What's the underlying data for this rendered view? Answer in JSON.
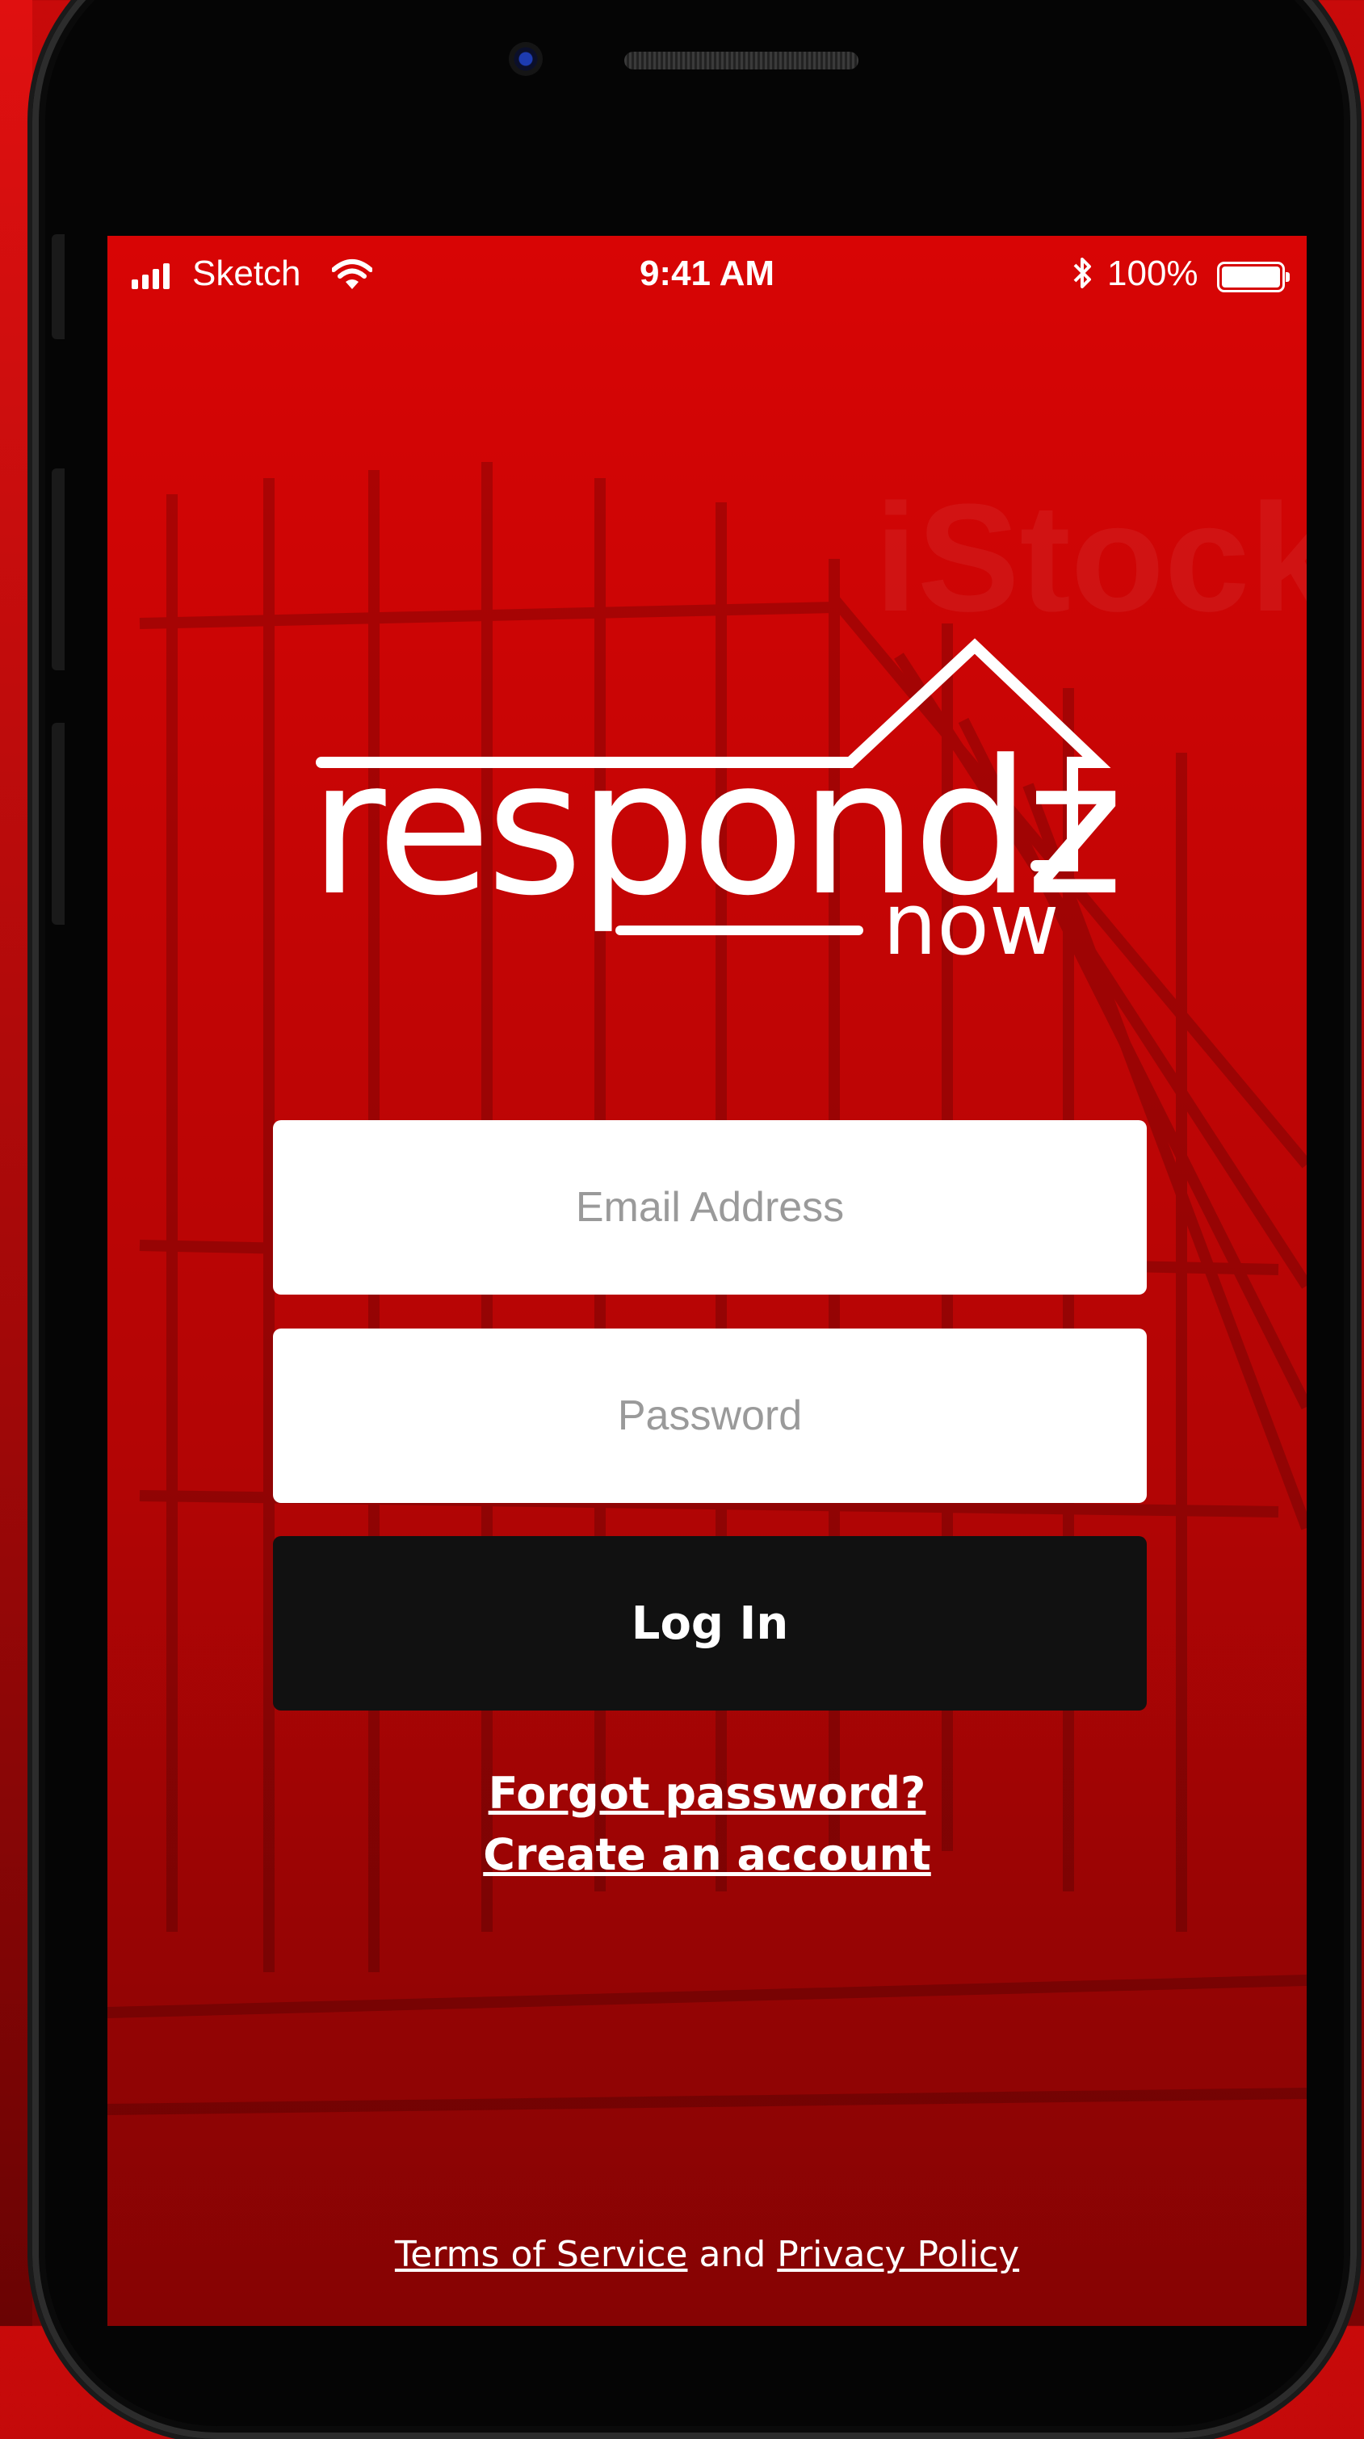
{
  "status_bar": {
    "carrier": "Sketch",
    "time": "9:41 AM",
    "battery_percent": "100%"
  },
  "logo": {
    "wordmark": "respondz",
    "subword": "now"
  },
  "watermark": "iStock",
  "form": {
    "email_placeholder": "Email Address",
    "password_placeholder": "Password",
    "login_label": "Log In"
  },
  "links": {
    "forgot_password": "Forgot password?",
    "create_account": "Create an account"
  },
  "legal": {
    "terms": "Terms of Service",
    "conjunction": "and",
    "privacy": "Privacy Policy"
  },
  "colors": {
    "brand_red": "#c80505",
    "button_dark": "#111111",
    "text_light": "#ffffff"
  }
}
